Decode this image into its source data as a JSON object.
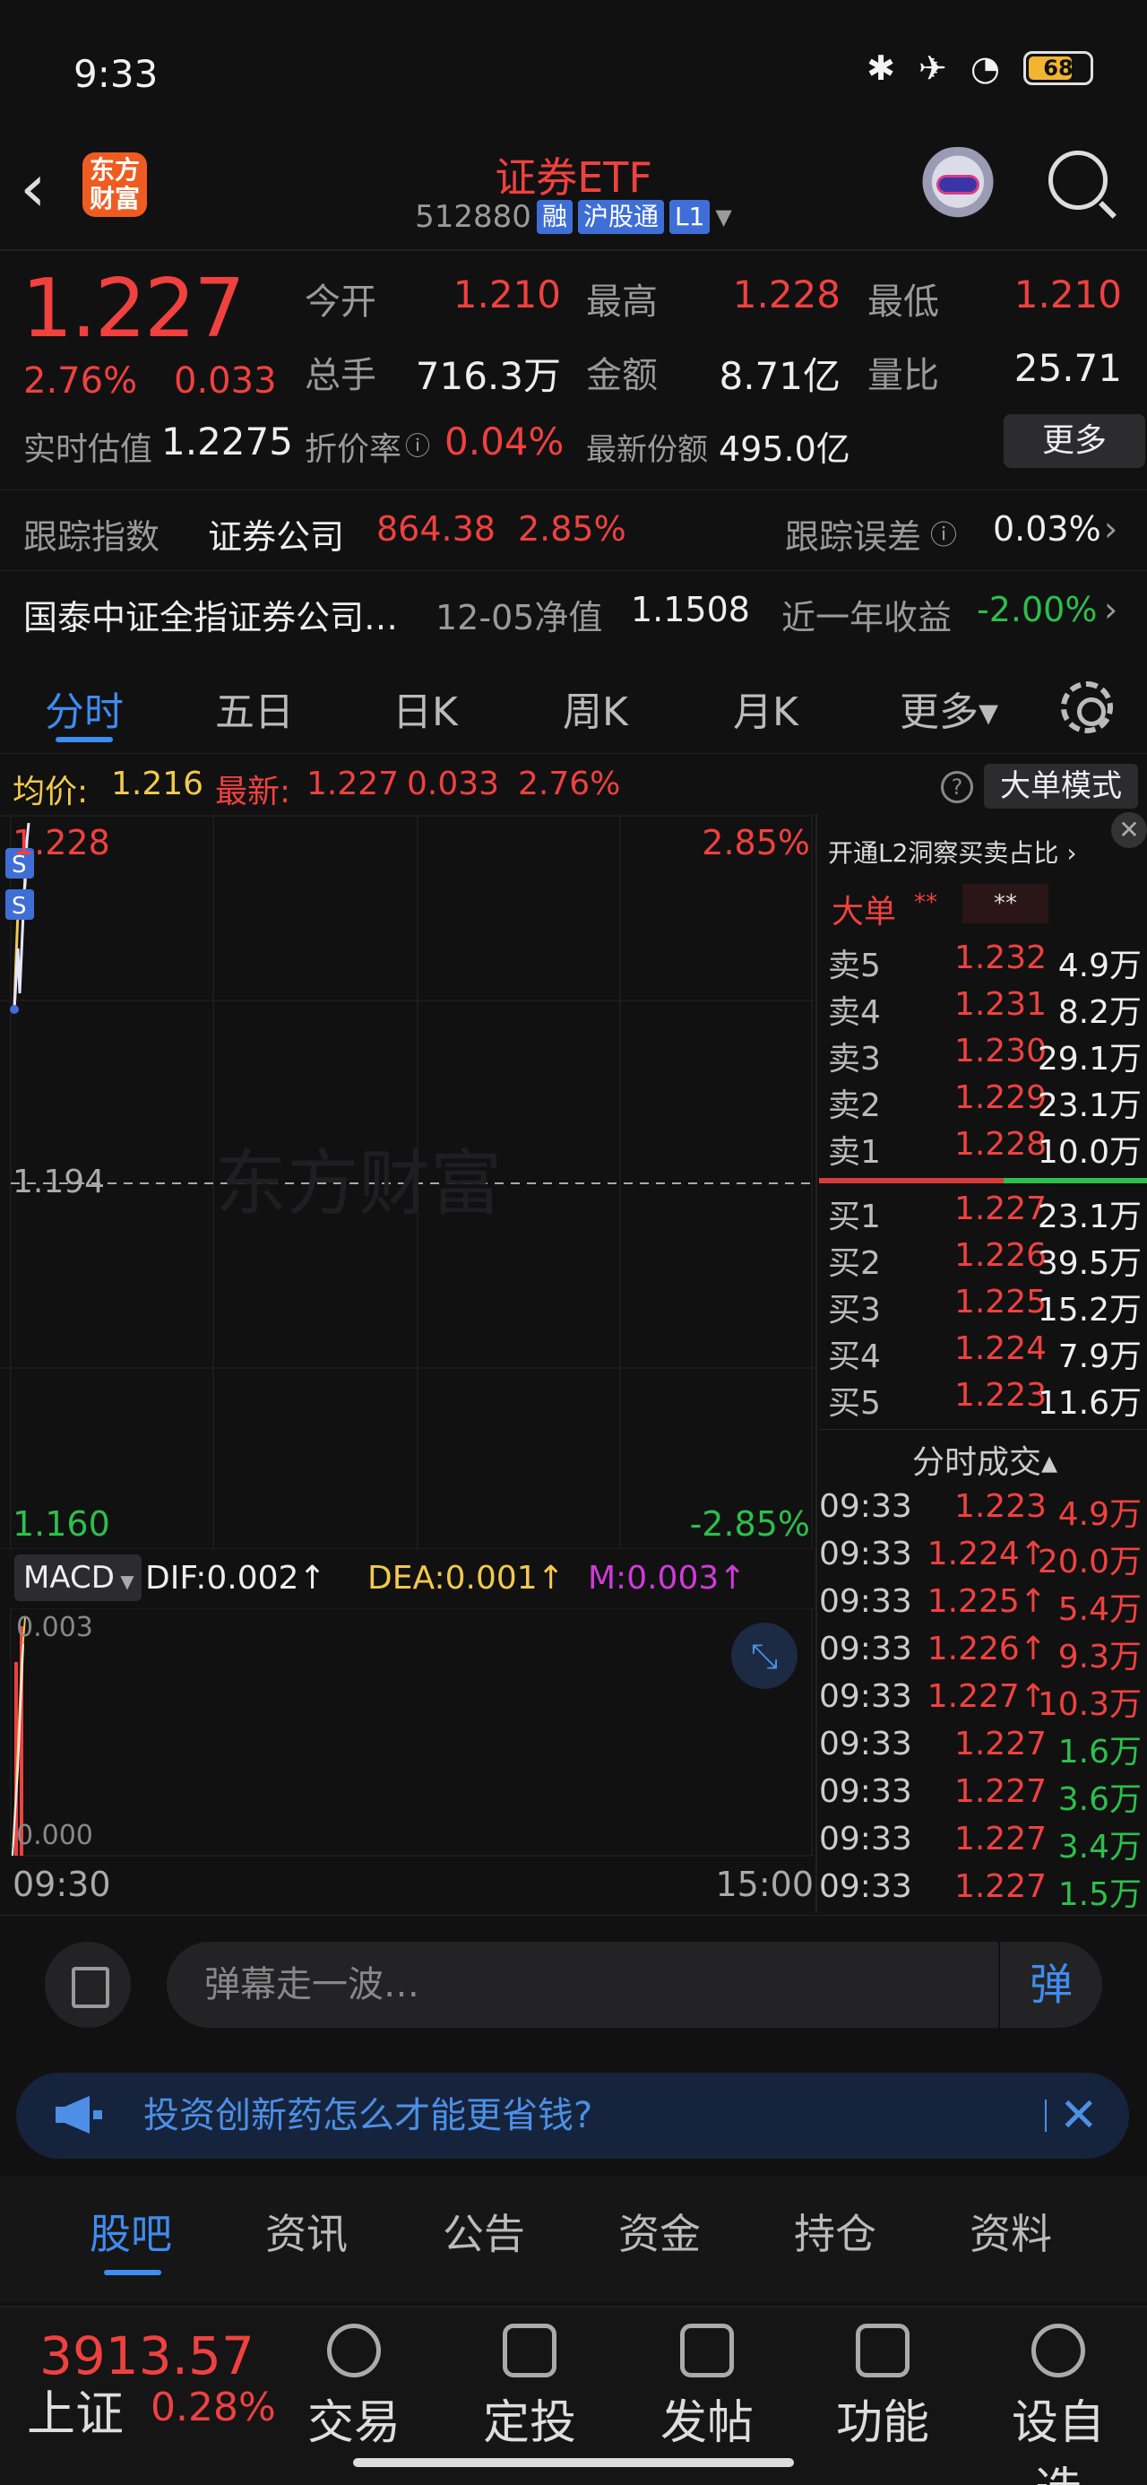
{
  "status": {
    "time": "9:33",
    "battery": "68"
  },
  "header": {
    "back_icon": "chevron-left-icon",
    "logo_text": "东方财富",
    "title": "证券ETF",
    "code": "512880",
    "tags": [
      "融",
      "沪股通",
      "L1"
    ]
  },
  "quote": {
    "price": "1.227",
    "change_pct": "2.76%",
    "change": "0.033",
    "open_label": "今开",
    "open": "1.210",
    "high_label": "最高",
    "high": "1.228",
    "low_label": "最低",
    "low": "1.210",
    "volume_label": "总手",
    "volume": "716.3万",
    "amount_label": "金额",
    "amount": "8.71亿",
    "ratio_label": "量比",
    "ratio": "25.71",
    "estimate_label": "实时估值",
    "estimate": "1.2275",
    "discount_label": "折价率",
    "discount": "0.04%",
    "shares_label": "最新份额",
    "shares": "495.0亿",
    "more": "更多"
  },
  "tracking": {
    "label": "跟踪指数",
    "index": "证券公司",
    "value": "864.38",
    "pct": "2.85%",
    "error_label": "跟踪误差",
    "error": "0.03%"
  },
  "fund": {
    "name": "国泰中证全指证券公司…",
    "nav_label": "12-05净值",
    "nav": "1.1508",
    "ret_label": "近一年收益",
    "ret": "-2.00%"
  },
  "tabs": [
    "分时",
    "五日",
    "日K",
    "周K",
    "月K",
    "更多▾"
  ],
  "avgline": {
    "avg_label": "均价:",
    "avg": "1.216",
    "last_label": "最新:",
    "last": "1.227",
    "chg": "0.033",
    "pct": "2.76%",
    "mode": "大单模式"
  },
  "chart": {
    "top_price": "1.228",
    "top_pct": "2.85%",
    "mid": "1.194",
    "bottom_price": "1.160",
    "bottom_pct": "-2.85%",
    "watermark": "东方财富",
    "macd": {
      "label": "MACD",
      "dif": "DIF:0.002↑",
      "dea": "DEA:0.001↑",
      "m": "M:0.003↑",
      "top": "0.003",
      "zero": "0.000"
    },
    "time_start": "09:30",
    "time_end": "15:00"
  },
  "orderbook": {
    "promo": "开通L2洞察买卖占比 ›",
    "big_label": "大单",
    "asks": [
      {
        "label": "卖5",
        "price": "1.232",
        "vol": "4.9万"
      },
      {
        "label": "卖4",
        "price": "1.231",
        "vol": "8.2万"
      },
      {
        "label": "卖3",
        "price": "1.230",
        "vol": "29.1万"
      },
      {
        "label": "卖2",
        "price": "1.229",
        "vol": "23.1万"
      },
      {
        "label": "卖1",
        "price": "1.228",
        "vol": "10.0万"
      }
    ],
    "bids": [
      {
        "label": "买1",
        "price": "1.227",
        "vol": "23.1万"
      },
      {
        "label": "买2",
        "price": "1.226",
        "vol": "39.5万"
      },
      {
        "label": "买3",
        "price": "1.225",
        "vol": "15.2万"
      },
      {
        "label": "买4",
        "price": "1.224",
        "vol": "7.9万"
      },
      {
        "label": "买5",
        "price": "1.223",
        "vol": "11.6万"
      }
    ],
    "trades_title": "分时成交▴",
    "trades": [
      {
        "t": "09:33",
        "p": "1.223",
        "v": "4.9万",
        "dir": "red"
      },
      {
        "t": "09:33",
        "p": "1.224↑",
        "v": "20.0万",
        "dir": "red"
      },
      {
        "t": "09:33",
        "p": "1.225↑",
        "v": "5.4万",
        "dir": "red"
      },
      {
        "t": "09:33",
        "p": "1.226↑",
        "v": "9.3万",
        "dir": "red"
      },
      {
        "t": "09:33",
        "p": "1.227↑",
        "v": "10.3万",
        "dir": "red"
      },
      {
        "t": "09:33",
        "p": "1.227",
        "v": "1.6万",
        "dir": "green"
      },
      {
        "t": "09:33",
        "p": "1.227",
        "v": "3.6万",
        "dir": "green"
      },
      {
        "t": "09:33",
        "p": "1.227",
        "v": "3.4万",
        "dir": "green"
      },
      {
        "t": "09:33",
        "p": "1.227",
        "v": "1.5万",
        "dir": "green"
      }
    ]
  },
  "comment": {
    "placeholder": "弹幕走一波…",
    "send": "弹"
  },
  "banner": {
    "text": "投资创新药怎么才能更省钱?",
    "close": "✕"
  },
  "bottom_tabs": [
    "股吧",
    "资讯",
    "公告",
    "资金",
    "持仓",
    "资料"
  ],
  "footer": {
    "index_value": "3913.57",
    "index_name": "上证",
    "index_pct": "0.28%",
    "items": [
      "交易",
      "定投",
      "发帖",
      "功能",
      "设自选"
    ]
  }
}
